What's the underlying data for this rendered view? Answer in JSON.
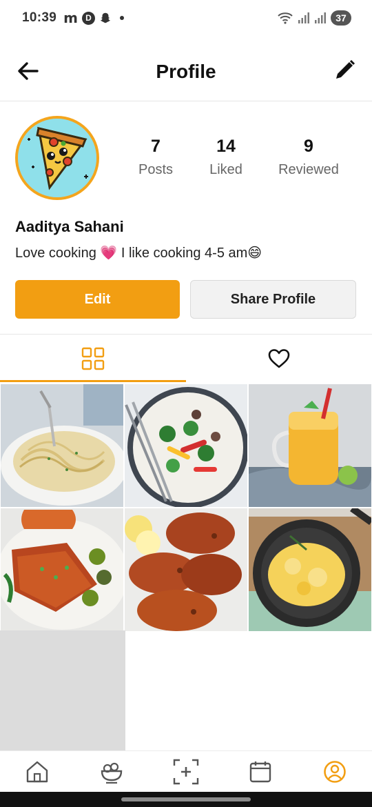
{
  "status_bar": {
    "time": "10:39",
    "left_icons": [
      "m-app-icon",
      "d-app-icon",
      "snapchat-icon",
      "dot-icon"
    ],
    "battery": "37"
  },
  "header": {
    "title": "Profile"
  },
  "profile": {
    "name": "Aaditya Sahani",
    "bio": "Love cooking 💗 I like cooking 4-5 am😄",
    "stats": [
      {
        "value": "7",
        "label": "Posts"
      },
      {
        "value": "14",
        "label": "Liked"
      },
      {
        "value": "9",
        "label": "Reviewed"
      }
    ]
  },
  "actions": {
    "edit_label": "Edit",
    "share_label": "Share Profile"
  },
  "tabs": [
    {
      "icon": "grid-icon",
      "active": true
    },
    {
      "icon": "heart-icon",
      "active": false
    }
  ],
  "posts": [
    {
      "dish": "spaghetti"
    },
    {
      "dish": "stir-fry vegetables"
    },
    {
      "dish": "mango smoothie"
    },
    {
      "dish": "glazed salmon"
    },
    {
      "dish": "roasted chicken"
    },
    {
      "dish": "scrambled eggs"
    }
  ],
  "bottom_nav": [
    {
      "icon": "home-icon"
    },
    {
      "icon": "food-bowl-icon"
    },
    {
      "icon": "add-post-icon"
    },
    {
      "icon": "calendar-icon"
    },
    {
      "icon": "profile-icon",
      "active": true
    }
  ],
  "colors": {
    "accent": "#f29e12",
    "text": "#111111",
    "muted": "#666666"
  }
}
